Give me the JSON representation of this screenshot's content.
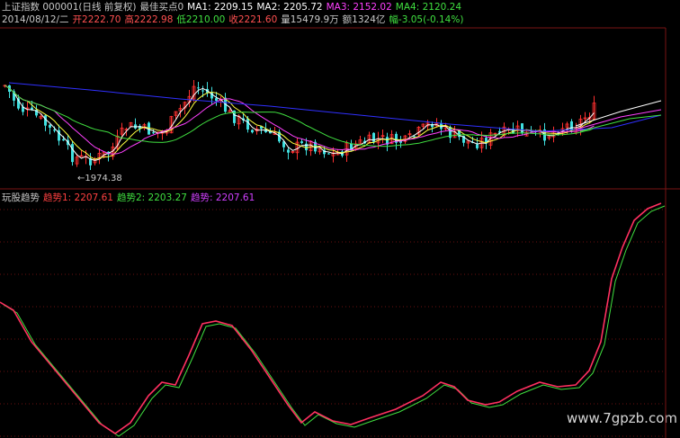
{
  "header": {
    "line1": [
      {
        "text": "上证指数 000001(日线 前复权)",
        "color": "#c8c8c8"
      },
      {
        "text": "最佳买点0",
        "color": "#c8c8c8"
      },
      {
        "text": "MA1: 2209.15",
        "color": "#ffffff"
      },
      {
        "text": "MA2: 2205.72",
        "color": "#ffffff"
      },
      {
        "text": "MA3: 2152.02",
        "color": "#ff40ff"
      },
      {
        "text": "MA4: 2120.24",
        "color": "#40e040"
      }
    ],
    "line2": [
      {
        "text": "2014/08/12/二",
        "color": "#c8c8c8"
      },
      {
        "text": "开2222.70",
        "color": "#ff5050"
      },
      {
        "text": "高2222.98",
        "color": "#ff5050"
      },
      {
        "text": "低2210.00",
        "color": "#40e040"
      },
      {
        "text": "收2221.60",
        "color": "#ff5050"
      },
      {
        "text": "量15479.9万",
        "color": "#c8c8c8"
      },
      {
        "text": "额1324亿",
        "color": "#c8c8c8"
      },
      {
        "text": "幅-3.05(-0.14%)",
        "color": "#40e040"
      }
    ]
  },
  "price_panel": {
    "low_annotation": "←1974.38",
    "low_value": 1974.38
  },
  "indicator_header": [
    {
      "text": "玩股趋势",
      "color": "#c8c8c8"
    },
    {
      "text": "趋势1: 2207.61",
      "color": "#ff4040"
    },
    {
      "text": "趋势2: 2203.27",
      "color": "#40e040"
    },
    {
      "text": "趋势: 2207.61",
      "color": "#d040ff"
    }
  ],
  "watermark": "www.7gpzb.com",
  "colors": {
    "background": "#000000",
    "up": "#ff3030",
    "down": "#40e0e0",
    "ma1": "#ffffff",
    "ma2": "#ffff40",
    "ma3": "#ff40ff",
    "ma4": "#40e040",
    "ma5": "#3030ff",
    "trend1": "#ff3060",
    "trend2": "#40e040",
    "grid": "#7a1414"
  }
}
